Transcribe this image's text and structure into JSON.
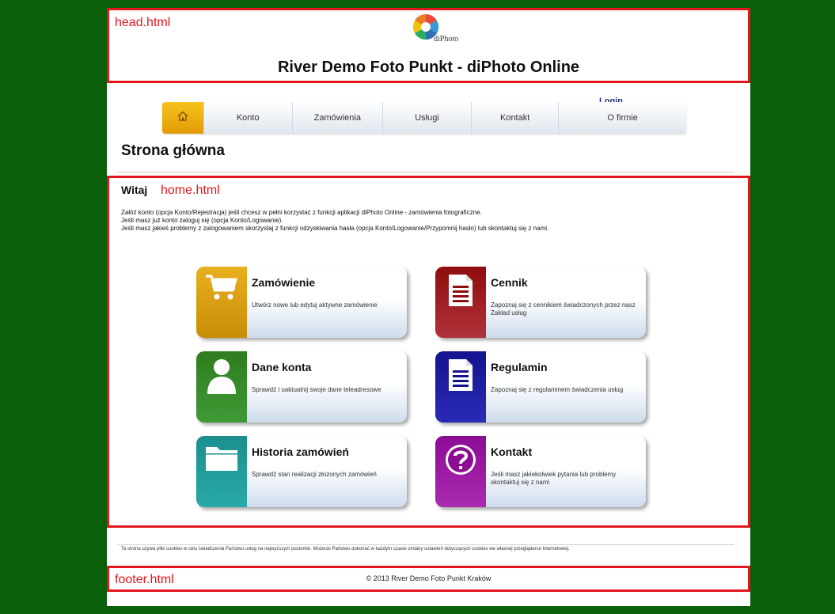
{
  "header": {
    "file_label": "head.html",
    "logo_text": "diPhoto",
    "site_title": "River Demo Foto Punkt - diPhoto Online"
  },
  "nav": {
    "login": "Login",
    "items": [
      {
        "label": "Konto"
      },
      {
        "label": "Zamówienia"
      },
      {
        "label": "Usługi"
      },
      {
        "label": "Kontakt"
      },
      {
        "label": "O firmie"
      }
    ]
  },
  "page_title": "Strona główna",
  "home": {
    "welcome": "Witaj",
    "file_label": "home.html",
    "intro": [
      "Załóż konto (opcja Konto/Rejestracja) jeśli chcesz w pełni korzystać z funkcji aplikacji diPhoto Online - zamówienia fotograficzne.",
      "Jeśli masz już konto zaloguj się (opcja Konto/Logowanie).",
      "Jeśli masz jakieś problemy z zalogowaniem skorzystaj z funkcji odzyskiwania hasła (opcja Konto/Logowanie/Przypomnij hasło) lub skontaktuj się z nami."
    ],
    "tiles": [
      {
        "title": "Zamówienie",
        "desc": "Utwórz nowe lub edytuj aktywne zamówienie",
        "icon": "cart-icon",
        "color": "#e0a20c"
      },
      {
        "title": "Cennik",
        "desc": "Zapoznaj się z cennikiem świadczonych przez nasz Zakład usług",
        "icon": "document-icon",
        "color": "#8f0d0d"
      },
      {
        "title": "Dane konta",
        "desc": "Sprawdź i uaktualnij swoje dane teleadresowe",
        "icon": "user-icon",
        "color": "#2d7a1e"
      },
      {
        "title": "Regulamin",
        "desc": "Zapoznaj się z regulaminem świadczenia usług",
        "icon": "document-icon",
        "color": "#14148f"
      },
      {
        "title": "Historia zamówień",
        "desc": "Sprawdź stan realizacji złożonych zamówień",
        "icon": "folder-icon",
        "color": "#1a9090"
      },
      {
        "title": "Kontakt",
        "desc": "Jeśli masz jakiekolwiek pytania lub problemy skontaktuj się z nami",
        "icon": "help-icon",
        "color": "#8d0c94"
      }
    ]
  },
  "cookie_notice": "Ta strona używa pliki cookies w celu świadczenia Państwu usług na najwyższym poziomie. Możecie Państwo dokonać w każdym czasie zmiany ustawień dotyczących cookies we własnej przeglądarce internetowej.",
  "footer": {
    "file_label": "footer.html",
    "copyright": "© 2013 River Demo Foto Punkt Kraków"
  },
  "colors": {
    "background": "#0a5f0a",
    "annotation_red": "#e3161e",
    "nav_home": "#f0b210",
    "login_link": "#1d2f7a"
  }
}
